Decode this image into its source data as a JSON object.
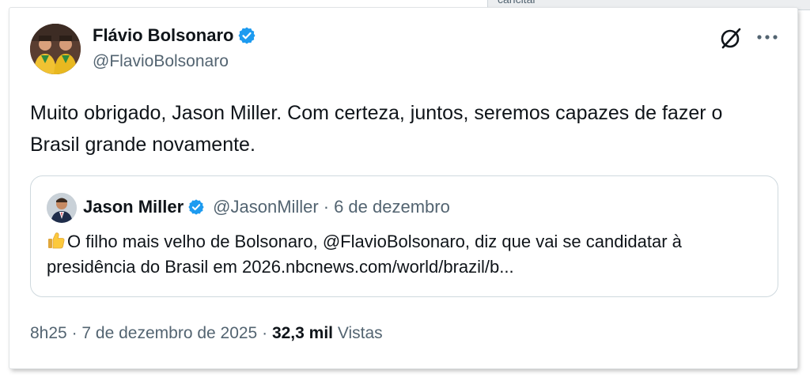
{
  "background": {
    "partial_text": "cancital"
  },
  "tweet": {
    "author_name": "Flávio Bolsonaro",
    "author_handle": "@FlavioBolsonaro",
    "text": "Muito obrigado, Jason Miller. Com certeza, juntos, seremos capazes de fazer o Brasil grande novamente.",
    "quoted": {
      "author_name": "Jason Miller",
      "author_handle": "@JasonMiller",
      "separator": "·",
      "date": "6 de dezembro",
      "emoji": "thumbs-up",
      "text": "O filho mais velho de Bolsonaro, @FlavioBolsonaro, diz que vai se candidatar à presidência do Brasil em 2026.nbcnews.com/world/brazil/b..."
    },
    "footer": {
      "time": "8h25",
      "sep1": "·",
      "date": "7 de dezembro de 2025",
      "sep2": "·",
      "views_count": "32,3 mil",
      "views_label": "Vistas"
    }
  },
  "icons": {
    "verified": "verified-badge-icon",
    "grok": "grok-icon",
    "more": "more-options-icon"
  },
  "colors": {
    "verified_blue": "#1d9bf0",
    "text_primary": "#0f1419",
    "text_secondary": "#536471",
    "border": "#cfd9de"
  }
}
